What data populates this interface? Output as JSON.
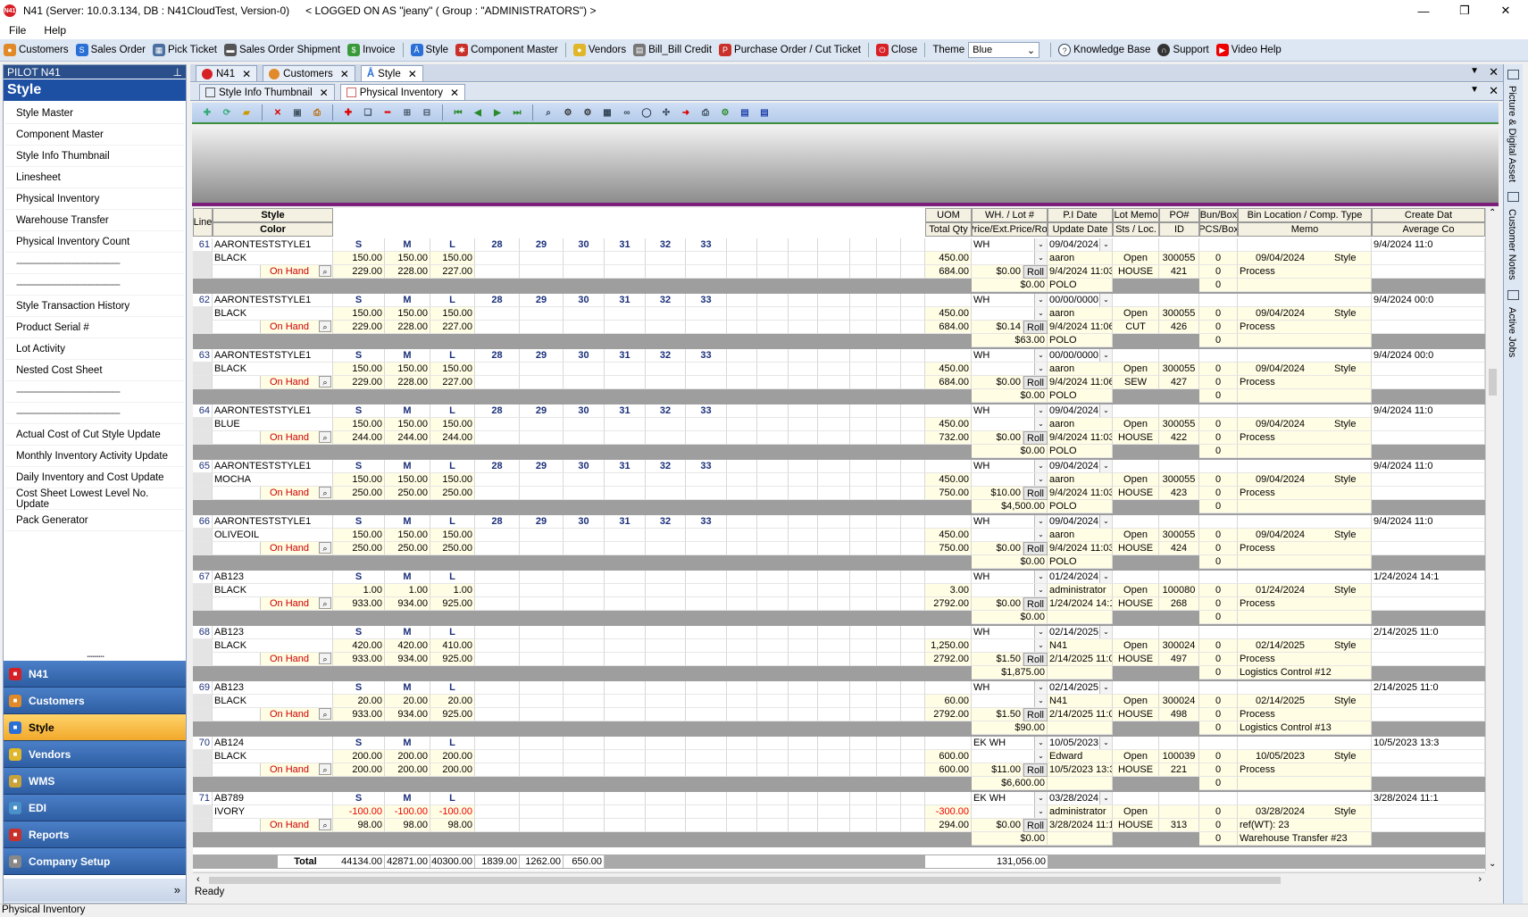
{
  "window": {
    "title": "N41  (Server: 10.0.3.134, DB : N41CloudTest, Version-0)",
    "logged": "< LOGGED ON AS \"jeany\" ( Group : \"ADMINISTRATORS\") >",
    "app_badge": "N41"
  },
  "menu": [
    "File",
    "Help"
  ],
  "toolbar": {
    "items": [
      "Customers",
      "Sales Order",
      "Pick Ticket",
      "Sales Order Shipment",
      "Invoice",
      "Style",
      "Component Master",
      "Vendors",
      "Bill_Bill Credit",
      "Purchase Order / Cut Ticket",
      "Close"
    ],
    "theme_label": "Theme",
    "theme_value": "Blue",
    "right": [
      "Knowledge Base",
      "Support",
      "Video Help"
    ]
  },
  "left": {
    "pilot": "PILOT N41",
    "section": "Style",
    "items": [
      "Style Master",
      "Component Master",
      "Style Info Thumbnail",
      "Linesheet",
      "Physical Inventory",
      "Warehouse Transfer",
      "Physical Inventory Count",
      "-----------------------------------------",
      "-----------------------------------------",
      "Style Transaction History",
      "Product Serial #",
      "Lot Activity",
      "Nested Cost Sheet",
      "-----------------------------------------",
      "-----------------------------------------",
      "Actual Cost of Cut Style Update",
      "Monthly Inventory Activity Update",
      "Daily Inventory and Cost Update",
      "Cost Sheet Lowest Level No. Update",
      "Pack Generator"
    ],
    "modules": [
      {
        "label": "N41",
        "color": "#d71f26"
      },
      {
        "label": "Customers",
        "color": "#e08a2a"
      },
      {
        "label": "Style",
        "color": "#2a6fd6"
      },
      {
        "label": "Vendors",
        "color": "#e0b62a"
      },
      {
        "label": "WMS",
        "color": "#c9a23a"
      },
      {
        "label": "EDI",
        "color": "#4a90c9"
      },
      {
        "label": "Reports",
        "color": "#c9302a"
      },
      {
        "label": "Company Setup",
        "color": "#888888"
      }
    ],
    "more": "»"
  },
  "tabs": [
    "N41",
    "Customers",
    "Style"
  ],
  "subtabs": [
    "Style Info Thumbnail",
    "Physical Inventory"
  ],
  "grid": {
    "headers_top": [
      "Line",
      "Style",
      "UOM",
      "WH. / Lot #",
      "P.I Date",
      "Lot Memo",
      "PO#",
      "Bun/Box",
      "Bin Location / Comp. Type",
      "Create Dat"
    ],
    "headers_bottom": [
      "Color",
      "Total Qty",
      "Price/Ext.Price/Roll",
      "Update Date",
      "Sts / Loc.",
      "ID",
      "PCS/Box",
      "Memo",
      "Average Co"
    ],
    "onhand_label": "On Hand",
    "roll_label": "Roll",
    "records": [
      {
        "line": "61",
        "style": "AARONTESTSTYLE1",
        "color": "BLACK",
        "sizes": [
          "S",
          "M",
          "L",
          "28",
          "29",
          "30",
          "31",
          "32",
          "33"
        ],
        "qty": [
          "150.00",
          "150.00",
          "150.00"
        ],
        "onhand": [
          "229.00",
          "228.00",
          "227.00"
        ],
        "total": "450.00",
        "ohtotal": "684.00",
        "wh": "WH",
        "price": "$0.00",
        "ext": "$0.00",
        "pidate": "09/04/2024",
        "user": "aaron",
        "upd": "9/4/2024 11:03:5",
        "memo": "POLO",
        "sts": "Open",
        "loc": "HOUSE",
        "po": "300055",
        "id": "421",
        "bun": "0",
        "bin": "09/04/2024",
        "comp": "Style",
        "m1": "Process",
        "m2": "",
        "create": "9/4/2024 11:0"
      },
      {
        "line": "62",
        "style": "AARONTESTSTYLE1",
        "color": "BLACK",
        "sizes": [
          "S",
          "M",
          "L",
          "28",
          "29",
          "30",
          "31",
          "32",
          "33"
        ],
        "qty": [
          "150.00",
          "150.00",
          "150.00"
        ],
        "onhand": [
          "229.00",
          "228.00",
          "227.00"
        ],
        "total": "450.00",
        "ohtotal": "684.00",
        "wh": "WH",
        "price": "$0.14",
        "ext": "$63.00",
        "pidate": "00/00/0000",
        "user": "aaron",
        "upd": "9/4/2024 11:06:0",
        "memo": "POLO",
        "sts": "Open",
        "loc": "CUT",
        "po": "300055",
        "id": "426",
        "bun": "0",
        "bin": "09/04/2024",
        "comp": "Style",
        "m1": "Process",
        "m2": "",
        "create": "9/4/2024 00:0"
      },
      {
        "line": "63",
        "style": "AARONTESTSTYLE1",
        "color": "BLACK",
        "sizes": [
          "S",
          "M",
          "L",
          "28",
          "29",
          "30",
          "31",
          "32",
          "33"
        ],
        "qty": [
          "150.00",
          "150.00",
          "150.00"
        ],
        "onhand": [
          "229.00",
          "228.00",
          "227.00"
        ],
        "total": "450.00",
        "ohtotal": "684.00",
        "wh": "WH",
        "price": "$0.00",
        "ext": "$0.00",
        "pidate": "00/00/0000",
        "user": "aaron",
        "upd": "9/4/2024 11:06:0",
        "memo": "POLO",
        "sts": "Open",
        "loc": "SEW",
        "po": "300055",
        "id": "427",
        "bun": "0",
        "bin": "09/04/2024",
        "comp": "Style",
        "m1": "Process",
        "m2": "",
        "create": "9/4/2024 00:0"
      },
      {
        "line": "64",
        "style": "AARONTESTSTYLE1",
        "color": "BLUE",
        "sizes": [
          "S",
          "M",
          "L",
          "28",
          "29",
          "30",
          "31",
          "32",
          "33"
        ],
        "qty": [
          "150.00",
          "150.00",
          "150.00"
        ],
        "onhand": [
          "244.00",
          "244.00",
          "244.00"
        ],
        "total": "450.00",
        "ohtotal": "732.00",
        "wh": "WH",
        "price": "$0.00",
        "ext": "$0.00",
        "pidate": "09/04/2024",
        "user": "aaron",
        "upd": "9/4/2024 11:03:5",
        "memo": "POLO",
        "sts": "Open",
        "loc": "HOUSE",
        "po": "300055",
        "id": "422",
        "bun": "0",
        "bin": "09/04/2024",
        "comp": "Style",
        "m1": "Process",
        "m2": "",
        "create": "9/4/2024 11:0"
      },
      {
        "line": "65",
        "style": "AARONTESTSTYLE1",
        "color": "MOCHA",
        "sizes": [
          "S",
          "M",
          "L",
          "28",
          "29",
          "30",
          "31",
          "32",
          "33"
        ],
        "qty": [
          "150.00",
          "150.00",
          "150.00"
        ],
        "onhand": [
          "250.00",
          "250.00",
          "250.00"
        ],
        "total": "450.00",
        "ohtotal": "750.00",
        "wh": "WH",
        "price": "$10.00",
        "ext": "$4,500.00",
        "pidate": "09/04/2024",
        "user": "aaron",
        "upd": "9/4/2024 11:03:5",
        "memo": "POLO",
        "sts": "Open",
        "loc": "HOUSE",
        "po": "300055",
        "id": "423",
        "bun": "0",
        "bin": "09/04/2024",
        "comp": "Style",
        "m1": "Process",
        "m2": "",
        "create": "9/4/2024 11:0"
      },
      {
        "line": "66",
        "style": "AARONTESTSTYLE1",
        "color": "OLIVEOIL",
        "sizes": [
          "S",
          "M",
          "L",
          "28",
          "29",
          "30",
          "31",
          "32",
          "33"
        ],
        "qty": [
          "150.00",
          "150.00",
          "150.00"
        ],
        "onhand": [
          "250.00",
          "250.00",
          "250.00"
        ],
        "total": "450.00",
        "ohtotal": "750.00",
        "wh": "WH",
        "price": "$0.00",
        "ext": "$0.00",
        "pidate": "09/04/2024",
        "user": "aaron",
        "upd": "9/4/2024 11:03:5",
        "memo": "POLO",
        "sts": "Open",
        "loc": "HOUSE",
        "po": "300055",
        "id": "424",
        "bun": "0",
        "bin": "09/04/2024",
        "comp": "Style",
        "m1": "Process",
        "m2": "",
        "create": "9/4/2024 11:0"
      },
      {
        "line": "67",
        "style": "AB123",
        "color": "BLACK",
        "sizes": [
          "S",
          "M",
          "L"
        ],
        "qty": [
          "1.00",
          "1.00",
          "1.00"
        ],
        "onhand": [
          "933.00",
          "934.00",
          "925.00"
        ],
        "total": "3.00",
        "ohtotal": "2792.00",
        "wh": "WH",
        "price": "$0.00",
        "ext": "$0.00",
        "pidate": "01/24/2024",
        "user": "administrator",
        "upd": "1/24/2024 14:16",
        "memo": "",
        "sts": "Open",
        "loc": "HOUSE",
        "po": "100080",
        "id": "268",
        "bun": "0",
        "bin": "01/24/2024",
        "comp": "Style",
        "m1": "Process",
        "m2": "",
        "create": "1/24/2024 14:1"
      },
      {
        "line": "68",
        "style": "AB123",
        "color": "BLACK",
        "sizes": [
          "S",
          "M",
          "L"
        ],
        "qty": [
          "420.00",
          "420.00",
          "410.00"
        ],
        "onhand": [
          "933.00",
          "934.00",
          "925.00"
        ],
        "total": "1,250.00",
        "ohtotal": "2792.00",
        "wh": "WH",
        "price": "$1.50",
        "ext": "$1,875.00",
        "pidate": "02/14/2025",
        "user": "N41",
        "upd": "2/14/2025 11:08",
        "memo": "",
        "sts": "Open",
        "loc": "HOUSE",
        "po": "300024",
        "id": "497",
        "bun": "0",
        "bin": "02/14/2025",
        "comp": "Style",
        "m1": "Process",
        "m2": "Logistics Control #12",
        "create": "2/14/2025 11:0"
      },
      {
        "line": "69",
        "style": "AB123",
        "color": "BLACK",
        "sizes": [
          "S",
          "M",
          "L"
        ],
        "qty": [
          "20.00",
          "20.00",
          "20.00"
        ],
        "onhand": [
          "933.00",
          "934.00",
          "925.00"
        ],
        "total": "60.00",
        "ohtotal": "2792.00",
        "wh": "WH",
        "price": "$1.50",
        "ext": "$90.00",
        "pidate": "02/14/2025",
        "user": "N41",
        "upd": "2/14/2025 11:08",
        "memo": "",
        "sts": "Open",
        "loc": "HOUSE",
        "po": "300024",
        "id": "498",
        "bun": "0",
        "bin": "02/14/2025",
        "comp": "Style",
        "m1": "Process",
        "m2": "Logistics Control #13",
        "create": "2/14/2025 11:0"
      },
      {
        "line": "70",
        "style": "AB124",
        "color": "BLACK",
        "sizes": [
          "S",
          "M",
          "L"
        ],
        "qty": [
          "200.00",
          "200.00",
          "200.00"
        ],
        "onhand": [
          "200.00",
          "200.00",
          "200.00"
        ],
        "total": "600.00",
        "ohtotal": "600.00",
        "wh": "EK WH",
        "price": "$11.00",
        "ext": "$6,600.00",
        "pidate": "10/05/2023",
        "user": "Edward",
        "upd": "10/5/2023 13:31",
        "memo": "",
        "sts": "Open",
        "loc": "HOUSE",
        "po": "100039",
        "id": "221",
        "bun": "0",
        "bin": "10/05/2023",
        "comp": "Style",
        "m1": "Process",
        "m2": "",
        "create": "10/5/2023 13:3"
      },
      {
        "line": "71",
        "style": "AB789",
        "color": "IVORY",
        "sizes": [
          "S",
          "M",
          "L"
        ],
        "qty": [
          "-100.00",
          "-100.00",
          "-100.00"
        ],
        "onhand": [
          "98.00",
          "98.00",
          "98.00"
        ],
        "total": "-300.00",
        "ohtotal": "294.00",
        "wh": "EK WH",
        "price": "$0.00",
        "ext": "$0.00",
        "pidate": "03/28/2024",
        "user": "administrator",
        "upd": "3/28/2024 11:19",
        "memo": "",
        "sts": "Open",
        "loc": "HOUSE",
        "po": "",
        "id": "313",
        "bun": "0",
        "bin": "03/28/2024",
        "comp": "Style",
        "m1": "ref(WT): 23",
        "m2": "Warehouse Transfer #23",
        "create": "3/28/2024 11:1"
      }
    ],
    "total_label": "Total",
    "totals": [
      "44134.00",
      "42871.00",
      "40300.00",
      "1839.00",
      "1262.00",
      "650.00"
    ],
    "grand_total": "131,056.00"
  },
  "right_rail": [
    "Picture & Digital Asset",
    "Customer Notes",
    "Active Jobs"
  ],
  "ready": "Ready",
  "status": "Physical Inventory"
}
